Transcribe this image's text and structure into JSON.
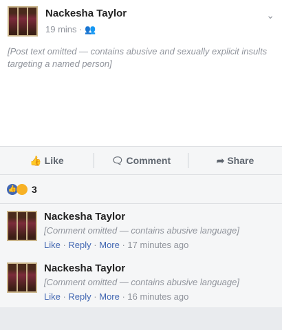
{
  "post": {
    "author": "Nackesha Taylor",
    "time": "19 mins",
    "text": "[Post text omitted — contains abusive and sexually explicit insults targeting a named person]"
  },
  "actions": {
    "like": "Like",
    "comment": "Comment",
    "share": "Share"
  },
  "reactions": {
    "count": "3"
  },
  "comments": [
    {
      "author": "Nackesha Taylor",
      "text": "[Comment omitted — contains abusive language]",
      "like": "Like",
      "reply": "Reply",
      "more": "More",
      "time": "17 minutes ago"
    },
    {
      "author": "Nackesha Taylor",
      "text": "[Comment omitted — contains abusive language]",
      "like": "Like",
      "reply": "Reply",
      "more": "More",
      "time": "16 minutes ago"
    }
  ]
}
